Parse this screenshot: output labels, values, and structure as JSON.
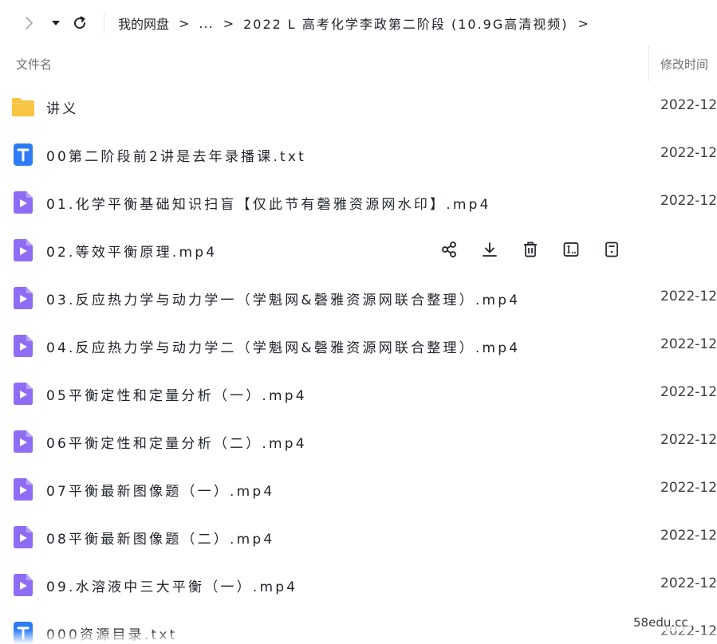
{
  "toolbar": {
    "back_icon": "chevron-right-icon",
    "dropdown_icon": "caret-down-icon",
    "refresh_icon": "refresh-icon"
  },
  "breadcrumb": {
    "root": "我的网盘",
    "separator": ">",
    "ellipsis": "...",
    "current": "2022 L 高考化学李政第二阶段 (10.9G高清视频)"
  },
  "columns": {
    "name": "文件名",
    "time": "修改时间"
  },
  "files": [
    {
      "type": "folder",
      "name": "讲义",
      "time": "2022-12"
    },
    {
      "type": "txt",
      "name": "00第二阶段前2讲是去年录播课.txt",
      "time": "2022-12"
    },
    {
      "type": "video",
      "name": "01.化学平衡基础知识扫盲【仅此节有磬雅资源网水印】.mp4",
      "time": "2022-12"
    },
    {
      "type": "video",
      "name": "02.等效平衡原理.mp4",
      "time": ""
    },
    {
      "type": "video",
      "name": "03.反应热力学与动力学一（学魁网&磬雅资源网联合整理）.mp4",
      "time": "2022-12"
    },
    {
      "type": "video",
      "name": "04.反应热力学与动力学二（学魁网&磬雅资源网联合整理）.mp4",
      "time": "2022-12"
    },
    {
      "type": "video",
      "name": "05平衡定性和定量分析（一）.mp4",
      "time": "2022-12"
    },
    {
      "type": "video",
      "name": "06平衡定性和定量分析（二）.mp4",
      "time": "2022-12"
    },
    {
      "type": "video",
      "name": "07平衡最新图像题（一）.mp4",
      "time": "2022-12"
    },
    {
      "type": "video",
      "name": "08平衡最新图像题（二）.mp4",
      "time": "2022-12"
    },
    {
      "type": "video",
      "name": "09.水溶液中三大平衡（一）.mp4",
      "time": "2022-12"
    },
    {
      "type": "txt",
      "name": "000资源目录.txt",
      "time": "2022-12"
    }
  ],
  "hover_actions": [
    "share-icon",
    "download-icon",
    "delete-icon",
    "rename-icon",
    "more-icon"
  ],
  "watermark": "58edu.cc",
  "colors": {
    "folder": "#f7c443",
    "txt": "#2d7cf6",
    "video": "#8f6cf4",
    "text": "#1f2329"
  }
}
